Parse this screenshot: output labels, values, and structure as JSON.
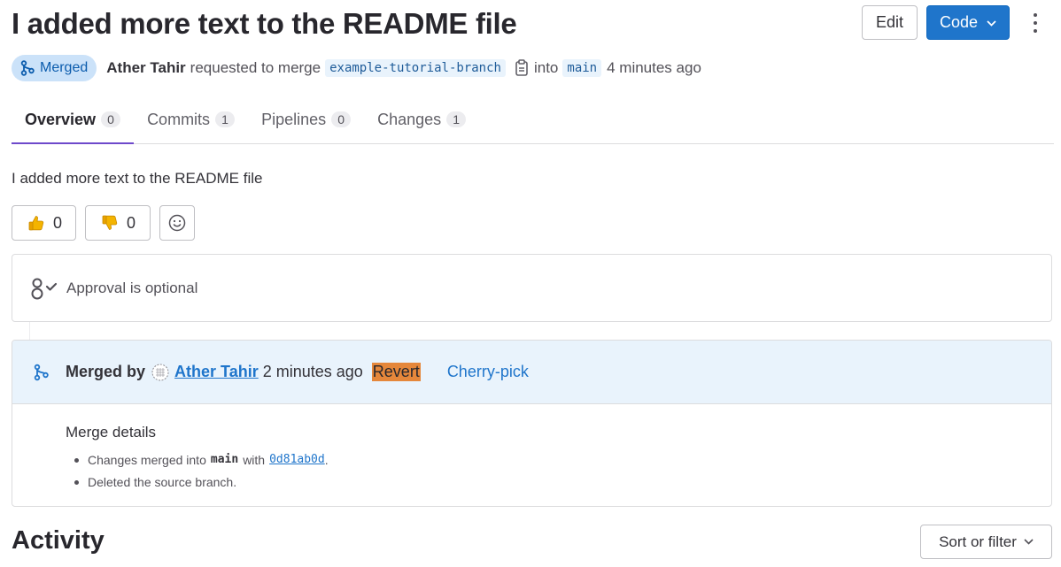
{
  "header": {
    "title": "I added more text to the README file",
    "edit_label": "Edit",
    "code_label": "Code"
  },
  "meta": {
    "status": "Merged",
    "author": "Ather Tahir",
    "action": "requested to merge",
    "source_branch": "example-tutorial-branch",
    "into": "into",
    "target_branch": "main",
    "time": "4 minutes ago"
  },
  "tabs": [
    {
      "label": "Overview",
      "count": "0"
    },
    {
      "label": "Commits",
      "count": "1"
    },
    {
      "label": "Pipelines",
      "count": "0"
    },
    {
      "label": "Changes",
      "count": "1"
    }
  ],
  "description": "I added more text to the README file",
  "awards": {
    "thumbs_up_count": "0",
    "thumbs_down_count": "0"
  },
  "approval": {
    "text": "Approval is optional"
  },
  "merged_panel": {
    "merged_by_label": "Merged by",
    "user": "Ather Tahir",
    "time": "2 minutes ago",
    "revert_label": "Revert",
    "cherry_pick_label": "Cherry-pick",
    "details_title": "Merge details",
    "line1_prefix": "Changes merged into",
    "line1_branch": "main",
    "line1_with": "with",
    "line1_sha": "0d81ab0d",
    "line1_suffix": ".",
    "line2": "Deleted the source branch."
  },
  "activity": {
    "title": "Activity",
    "sort_label": "Sort or filter"
  },
  "colors": {
    "primary": "#1f75cb",
    "merged_badge_bg": "#cbe2f9",
    "tab_underline": "#6e49cb",
    "revert_highlight": "#e5873b"
  }
}
